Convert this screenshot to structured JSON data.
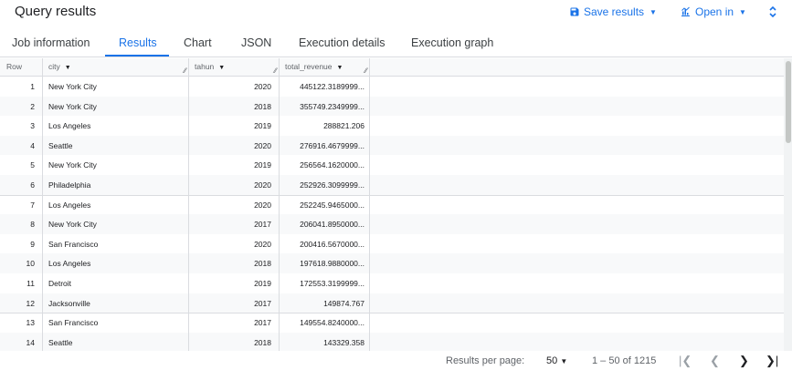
{
  "header": {
    "title": "Query results",
    "save_label": "Save results",
    "open_label": "Open in"
  },
  "tabs": [
    {
      "label": "Job information"
    },
    {
      "label": "Results"
    },
    {
      "label": "Chart"
    },
    {
      "label": "JSON"
    },
    {
      "label": "Execution details"
    },
    {
      "label": "Execution graph"
    }
  ],
  "table": {
    "columns": [
      "Row",
      "city",
      "tahun",
      "total_revenue"
    ],
    "rows": [
      {
        "row": "1",
        "city": "New York City",
        "tahun": "2020",
        "total_revenue": "445122.3189999..."
      },
      {
        "row": "2",
        "city": "New York City",
        "tahun": "2018",
        "total_revenue": "355749.2349999..."
      },
      {
        "row": "3",
        "city": "Los Angeles",
        "tahun": "2019",
        "total_revenue": "288821.206"
      },
      {
        "row": "4",
        "city": "Seattle",
        "tahun": "2020",
        "total_revenue": "276916.4679999..."
      },
      {
        "row": "5",
        "city": "New York City",
        "tahun": "2019",
        "total_revenue": "256564.1620000..."
      },
      {
        "row": "6",
        "city": "Philadelphia",
        "tahun": "2020",
        "total_revenue": "252926.3099999..."
      },
      {
        "row": "7",
        "city": "Los Angeles",
        "tahun": "2020",
        "total_revenue": "252245.9465000..."
      },
      {
        "row": "8",
        "city": "New York City",
        "tahun": "2017",
        "total_revenue": "206041.8950000..."
      },
      {
        "row": "9",
        "city": "San Francisco",
        "tahun": "2020",
        "total_revenue": "200416.5670000..."
      },
      {
        "row": "10",
        "city": "Los Angeles",
        "tahun": "2018",
        "total_revenue": "197618.9880000..."
      },
      {
        "row": "11",
        "city": "Detroit",
        "tahun": "2019",
        "total_revenue": "172553.3199999..."
      },
      {
        "row": "12",
        "city": "Jacksonville",
        "tahun": "2017",
        "total_revenue": "149874.767"
      },
      {
        "row": "13",
        "city": "San Francisco",
        "tahun": "2017",
        "total_revenue": "149554.8240000..."
      },
      {
        "row": "14",
        "city": "Seattle",
        "tahun": "2018",
        "total_revenue": "143329.358"
      }
    ]
  },
  "footer": {
    "per_page_label": "Results per page:",
    "per_page_value": "50",
    "range": "1 – 50 of 1215"
  },
  "icons": {
    "save": "save-icon",
    "open": "chart-icon",
    "expand": "expand-icon",
    "first": "first-page-icon",
    "prev": "prev-page-icon",
    "next": "next-page-icon",
    "last": "last-page-icon"
  },
  "colors": {
    "accent": "#1a73e8",
    "text": "#202124",
    "muted": "#5f6368",
    "border": "#dadce0",
    "alt_row": "#f8f9fa"
  }
}
